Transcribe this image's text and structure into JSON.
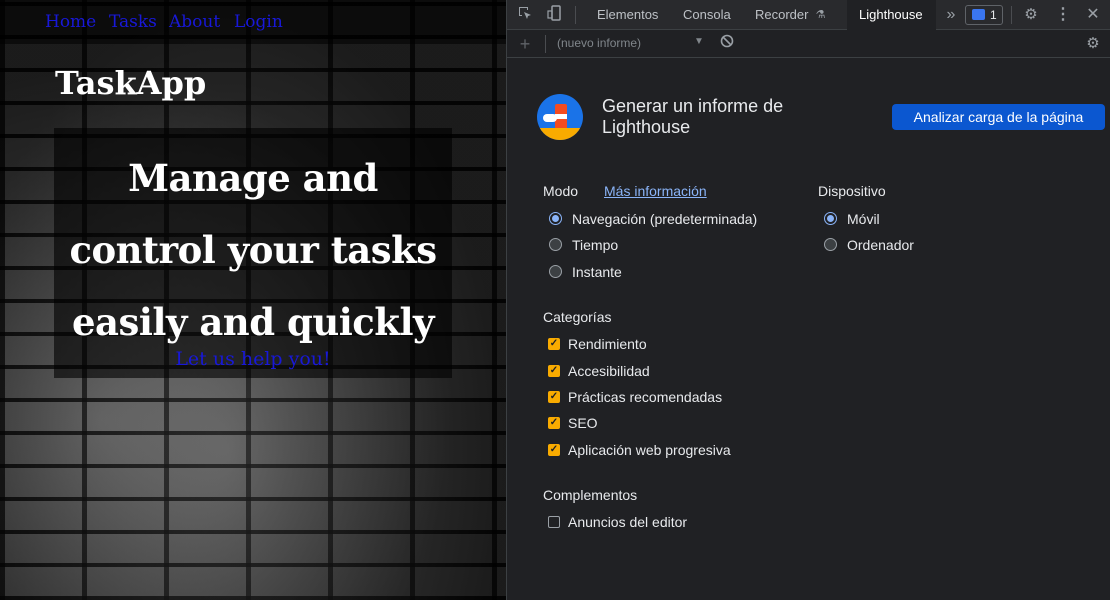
{
  "site": {
    "nav": [
      "Home",
      "Tasks",
      "About",
      "Login"
    ],
    "brand": "TaskApp",
    "hero_lines": [
      "Manage and",
      "control your tasks",
      "easily and quickly"
    ],
    "hero_sub": "Let us help you!",
    "link_color": "#1818d8"
  },
  "devtools": {
    "tabs": [
      "Elementos",
      "Consola",
      "Recorder",
      "Lighthouse"
    ],
    "active_tab": "Lighthouse",
    "issues_count": "1",
    "report_select": "(nuevo informe)",
    "header_title": "Generar un informe de Lighthouse",
    "analyze_button": "Analizar carga de la página",
    "mode": {
      "label": "Modo",
      "more_info": "Más información",
      "options": [
        "Navegación (predeterminada)",
        "Tiempo",
        "Instante"
      ],
      "selected": "Navegación (predeterminada)"
    },
    "device": {
      "label": "Dispositivo",
      "options": [
        "Móvil",
        "Ordenador"
      ],
      "selected": "Móvil"
    },
    "categories": {
      "label": "Categorías",
      "items": [
        "Rendimiento",
        "Accesibilidad",
        "Prácticas recomendadas",
        "SEO",
        "Aplicación web progresiva"
      ]
    },
    "plugins": {
      "label": "Complementos",
      "items": [
        "Anuncios del editor"
      ]
    },
    "accent_color": "#8ab4f8",
    "checkbox_color": "#f9ab00",
    "button_color": "#0b57d0"
  }
}
